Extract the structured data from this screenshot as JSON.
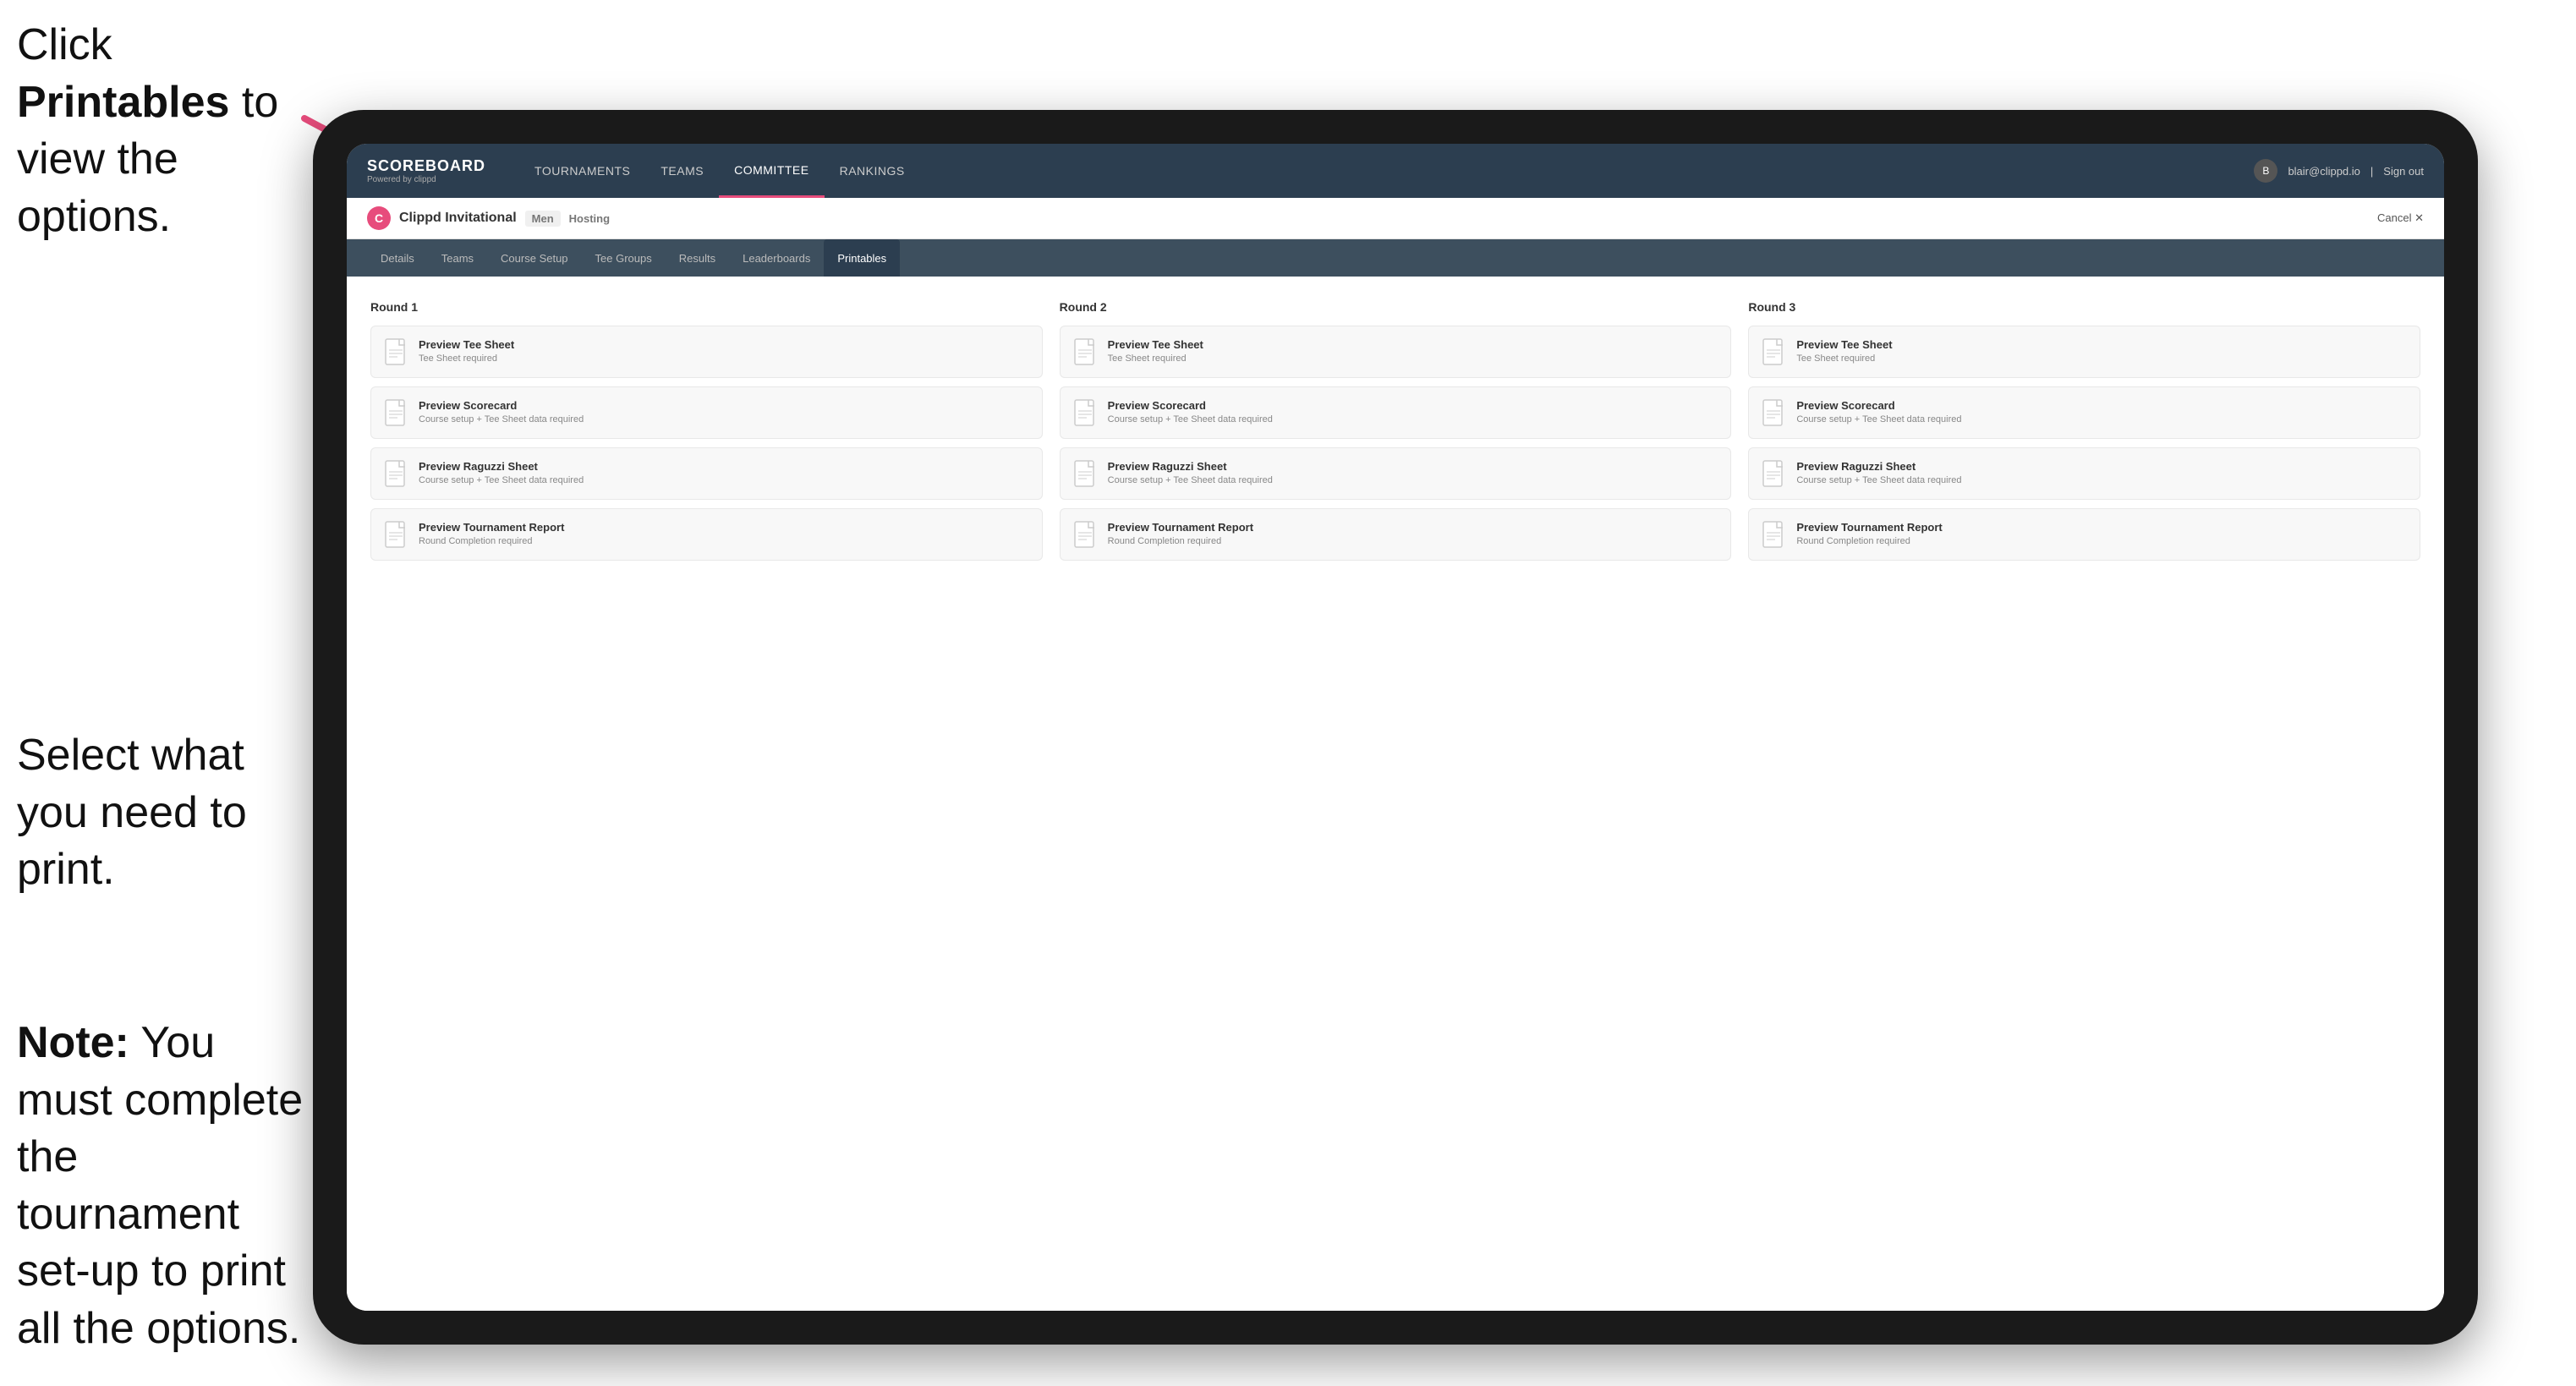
{
  "annotations": {
    "top": {
      "text_before": "Click ",
      "bold": "Printables",
      "text_after": " to view the options."
    },
    "middle": {
      "line1": "Select what you",
      "line2": "need to print."
    },
    "bottom": {
      "line1": "Note:",
      "line2": " You must complete the tournament set-up to print all the options."
    }
  },
  "nav": {
    "logo": "SCOREBOARD",
    "logo_sub": "Powered by clippd",
    "links": [
      {
        "label": "TOURNAMENTS",
        "active": false
      },
      {
        "label": "TEAMS",
        "active": false
      },
      {
        "label": "COMMITTEE",
        "active": false
      },
      {
        "label": "RANKINGS",
        "active": false
      }
    ],
    "user_email": "blair@clippd.io",
    "sign_out": "Sign out"
  },
  "tournament": {
    "name": "Clippd Invitational",
    "bracket": "Men",
    "hosting": "Hosting",
    "cancel": "Cancel"
  },
  "sub_tabs": [
    {
      "label": "Details",
      "active": false
    },
    {
      "label": "Teams",
      "active": false
    },
    {
      "label": "Course Setup",
      "active": false
    },
    {
      "label": "Tee Groups",
      "active": false
    },
    {
      "label": "Results",
      "active": false
    },
    {
      "label": "Leaderboards",
      "active": false
    },
    {
      "label": "Printables",
      "active": true
    }
  ],
  "rounds": [
    {
      "title": "Round 1",
      "items": [
        {
          "title": "Preview Tee Sheet",
          "subtitle": "Tee Sheet required"
        },
        {
          "title": "Preview Scorecard",
          "subtitle": "Course setup + Tee Sheet data required"
        },
        {
          "title": "Preview Raguzzi Sheet",
          "subtitle": "Course setup + Tee Sheet data required"
        },
        {
          "title": "Preview Tournament Report",
          "subtitle": "Round Completion required"
        }
      ]
    },
    {
      "title": "Round 2",
      "items": [
        {
          "title": "Preview Tee Sheet",
          "subtitle": "Tee Sheet required"
        },
        {
          "title": "Preview Scorecard",
          "subtitle": "Course setup + Tee Sheet data required"
        },
        {
          "title": "Preview Raguzzi Sheet",
          "subtitle": "Course setup + Tee Sheet data required"
        },
        {
          "title": "Preview Tournament Report",
          "subtitle": "Round Completion required"
        }
      ]
    },
    {
      "title": "Round 3",
      "items": [
        {
          "title": "Preview Tee Sheet",
          "subtitle": "Tee Sheet required"
        },
        {
          "title": "Preview Scorecard",
          "subtitle": "Course setup + Tee Sheet data required"
        },
        {
          "title": "Preview Raguzzi Sheet",
          "subtitle": "Course setup + Tee Sheet data required"
        },
        {
          "title": "Preview Tournament Report",
          "subtitle": "Round Completion required"
        }
      ]
    }
  ]
}
